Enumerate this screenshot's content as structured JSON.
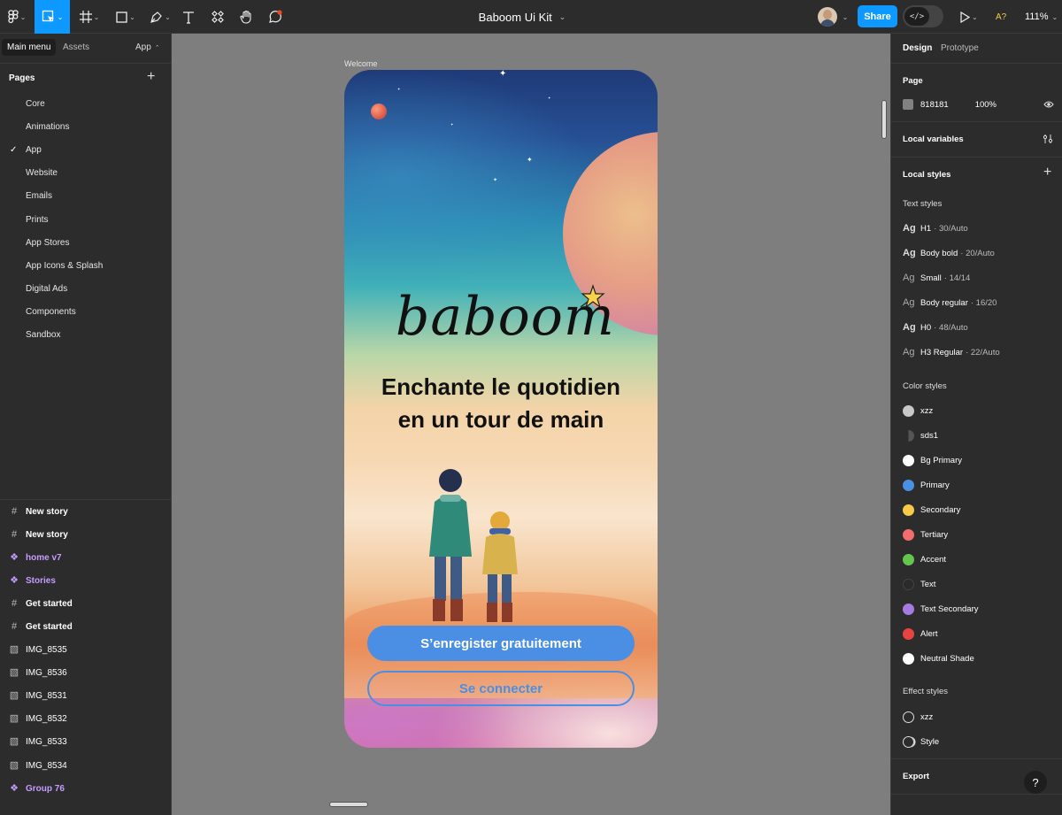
{
  "toolbar": {
    "file_title": "Baboom Ui Kit",
    "share_label": "Share",
    "dev_mode_label": "</>",
    "font_warning": "A?",
    "zoom": "111%"
  },
  "left_panel": {
    "main_menu_label": "Main menu",
    "assets_label": "Assets",
    "page_selector": "App",
    "pages_title": "Pages",
    "pages": [
      "Core",
      "Animations",
      "App",
      "Website",
      "Emails",
      "Prints",
      "App Stores",
      "App Icons & Splash",
      "Digital Ads",
      "Components",
      "Sandbox"
    ],
    "active_page": "App",
    "layers": [
      {
        "name": "New story",
        "kind": "frame"
      },
      {
        "name": "New story",
        "kind": "frame"
      },
      {
        "name": "home v7",
        "kind": "component"
      },
      {
        "name": "Stories",
        "kind": "component"
      },
      {
        "name": "Get started",
        "kind": "frame"
      },
      {
        "name": "Get started",
        "kind": "frame"
      },
      {
        "name": "IMG_8535",
        "kind": "image"
      },
      {
        "name": "IMG_8536",
        "kind": "image"
      },
      {
        "name": "IMG_8531",
        "kind": "image"
      },
      {
        "name": "IMG_8532",
        "kind": "image"
      },
      {
        "name": "IMG_8533",
        "kind": "image"
      },
      {
        "name": "IMG_8534",
        "kind": "image"
      },
      {
        "name": "Group 76",
        "kind": "component"
      }
    ]
  },
  "canvas": {
    "frame_label": "Welcome",
    "logo_text": "baboom",
    "headline_line1": "Enchante le quotidien",
    "headline_line2": "en un tour de main",
    "primary_button": "S’enregister gratuitement",
    "secondary_button": "Se connecter"
  },
  "right_panel": {
    "tab_design": "Design",
    "tab_prototype": "Prototype",
    "page_section": "Page",
    "page_color": "818181",
    "page_opacity": "100%",
    "local_variables": "Local variables",
    "local_styles": "Local styles",
    "text_styles_title": "Text styles",
    "text_styles": [
      {
        "name": "H1",
        "meta": "· 30/Auto"
      },
      {
        "name": "Body bold",
        "meta": "· 20/Auto"
      },
      {
        "name": "Small",
        "meta": "· 14/14"
      },
      {
        "name": "Body regular",
        "meta": "· 16/20"
      },
      {
        "name": "H0",
        "meta": "· 48/Auto"
      },
      {
        "name": "H3 Regular",
        "meta": "· 22/Auto"
      }
    ],
    "color_styles_title": "Color styles",
    "color_styles": [
      {
        "name": "xzz",
        "color": "#c8c8c8"
      },
      {
        "name": "sds1",
        "color": "#3a3a3a"
      },
      {
        "name": "Bg Primary",
        "color": "#ffffff"
      },
      {
        "name": "Primary",
        "color": "#4a8fe3"
      },
      {
        "name": "Secondary",
        "color": "#f7c948"
      },
      {
        "name": "Tertiary",
        "color": "#f26d6d"
      },
      {
        "name": "Accent",
        "color": "#63c74d"
      },
      {
        "name": "Text",
        "color": "#2a2a2a"
      },
      {
        "name": "Text Secondary",
        "color": "#a57be0"
      },
      {
        "name": "Alert",
        "color": "#e84343"
      },
      {
        "name": "Neutral Shade",
        "color": "#ffffff"
      }
    ],
    "effect_styles_title": "Effect styles",
    "effect_styles": [
      "xzz",
      "Style"
    ],
    "export_label": "Export",
    "help_label": "?"
  },
  "colors": {
    "accent": "#0d99ff",
    "canvas_bg": "#818181",
    "panel_bg": "#2c2c2c"
  }
}
